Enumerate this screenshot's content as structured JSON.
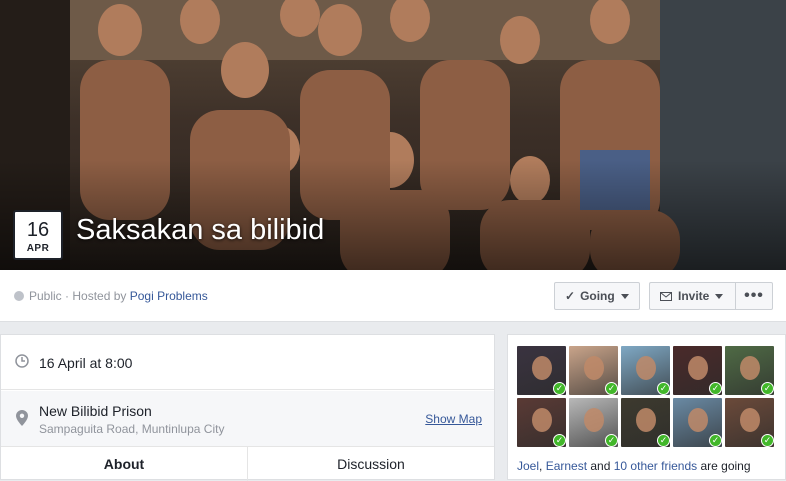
{
  "event": {
    "day": "16",
    "month": "APR",
    "title": "Saksakan sa bilibid"
  },
  "meta": {
    "privacy": "Public",
    "separator": " · Hosted by ",
    "host": "Pogi Problems"
  },
  "actions": {
    "going_label": "Going",
    "invite_label": "Invite",
    "more_label": "•••"
  },
  "details": {
    "datetime": "16 April at 8:00",
    "place_name": "New Bilibid Prison",
    "place_address": "Sampaguita Road, Muntinlupa City",
    "show_map": "Show Map"
  },
  "tabs": {
    "about": "About",
    "discussion": "Discussion"
  },
  "guests": {
    "friend1": "Joel",
    "comma": ", ",
    "friend2": "Earnest",
    "and_text": " and ",
    "others": "10 other friends",
    "suffix": " are going",
    "avatar_colors": [
      "#3a3340",
      "#c9a48a",
      "#7fa8c4",
      "#4a2a2a",
      "#4f6a45",
      "#5a3a35",
      "#b8b8b8",
      "#3d3a2e",
      "#6a8aa4",
      "#6b4a3a"
    ]
  },
  "icons": {
    "check": "✓",
    "clock": "clock-icon",
    "pin": "map-pin-icon"
  }
}
